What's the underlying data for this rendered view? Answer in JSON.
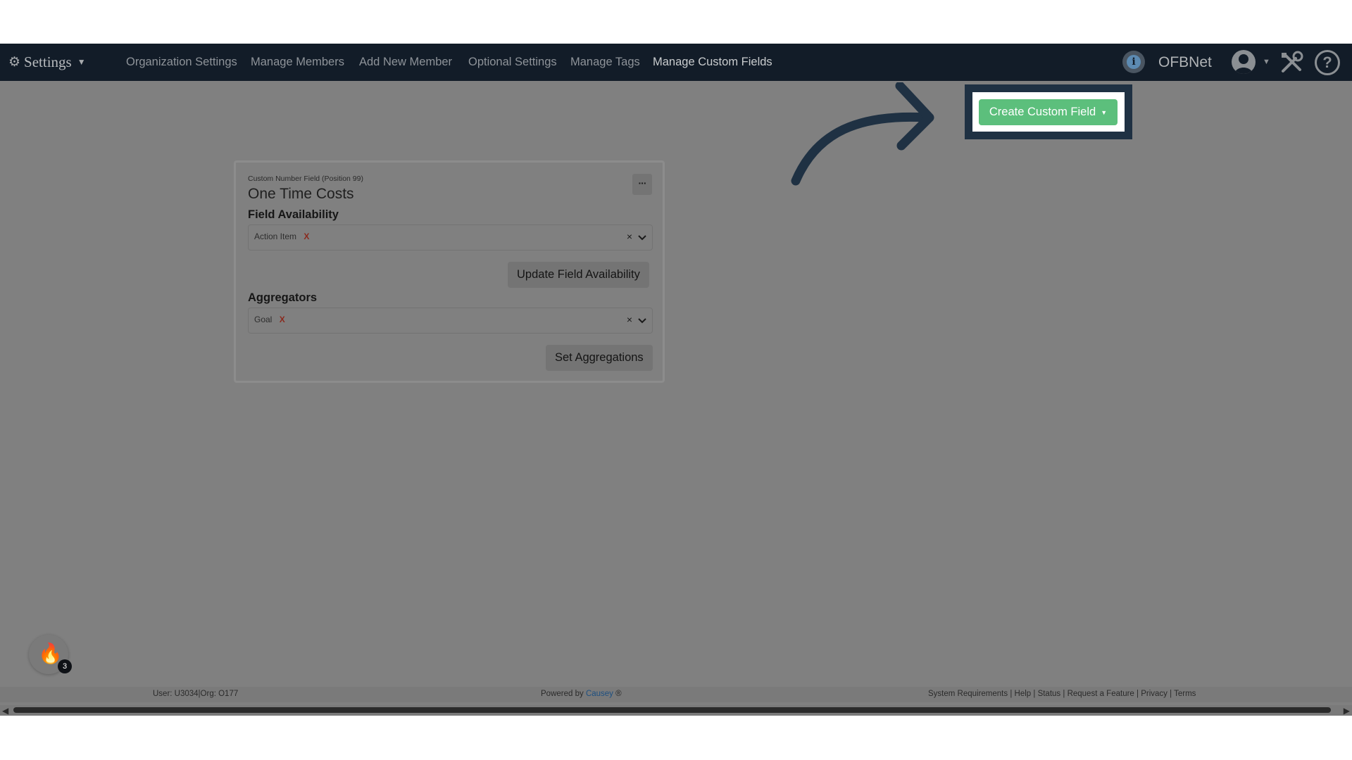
{
  "navbar": {
    "settings_label": "Settings",
    "links": [
      {
        "label": "Organization Settings"
      },
      {
        "label": "Manage Members"
      },
      {
        "label": "Add New Member"
      },
      {
        "label": "Optional Settings"
      },
      {
        "label": "Manage Tags"
      },
      {
        "label": "Manage Custom Fields",
        "active": true
      }
    ],
    "org_name": "OFBNet",
    "info_glyph": "i",
    "help_glyph": "?",
    "icons": [
      "gear-icon",
      "info-icon",
      "user-avatar-icon",
      "tools-icon",
      "help-icon"
    ]
  },
  "create_button": {
    "label": "Create Custom Field",
    "color": "#5cbf7c"
  },
  "card": {
    "subtitle": "Custom Number Field (Position 99)",
    "title": "One Time Costs",
    "more_glyph": "···",
    "field_availability": {
      "label": "Field Availability",
      "chip": "Action Item",
      "chip_remove": "X",
      "clear_glyph": "×",
      "button": "Update Field Availability"
    },
    "aggregators": {
      "label": "Aggregators",
      "chip": "Goal",
      "chip_remove": "X",
      "clear_glyph": "×",
      "button": "Set Aggregations"
    }
  },
  "notification_badge": {
    "count": "3"
  },
  "footer": {
    "user_info": "User: U3034|Org: O177",
    "powered_prefix": "Powered by ",
    "powered_brand": "Causey",
    "powered_suffix": " ®",
    "links": [
      "System Requirements",
      "Help",
      "Status",
      "Request a Feature",
      "Privacy",
      "Terms"
    ]
  },
  "colors": {
    "navbar_bg": "#121c28",
    "overlay": "#808080",
    "highlight_border": "#1f3143"
  }
}
